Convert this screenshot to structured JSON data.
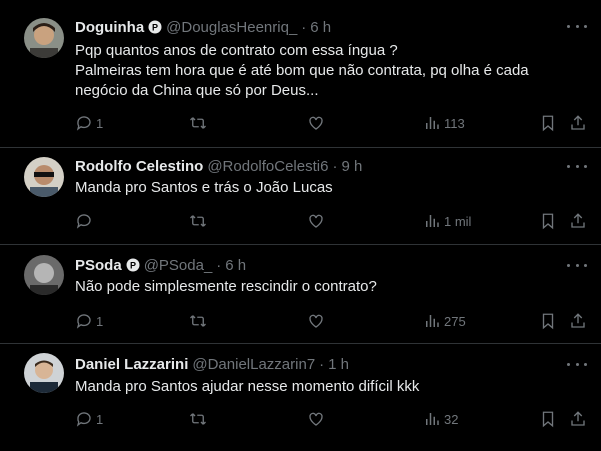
{
  "tweets": [
    {
      "name": "Doguinha",
      "handle": "@DouglasHeenriq_",
      "time": "6 h",
      "text_lines": [
        "Pqp quantos anos de contrato com essa íngua ?",
        "Palmeiras tem hora que é até bom que não contrata, pq olha é cada",
        "negócio da China que só por Deus..."
      ],
      "replies": "1",
      "views": "113",
      "verified": true
    },
    {
      "name": "Rodolfo Celestino",
      "handle": "@RodolfoCelesti6",
      "time": "9 h",
      "text_lines": [
        "Manda pro Santos e trás o João Lucas"
      ],
      "replies": "",
      "views": "1 mil",
      "verified": false
    },
    {
      "name": "PSoda",
      "handle": "@PSoda_",
      "time": "6 h",
      "text_lines": [
        "Não pode simplesmente rescindir o contrato?"
      ],
      "replies": "1",
      "views": "275",
      "verified": true
    },
    {
      "name": "Daniel Lazzarini",
      "handle": "@DanielLazzarin7",
      "time": "1 h",
      "text_lines": [
        "Manda pro Santos ajudar nesse momento difícil kkk"
      ],
      "replies": "1",
      "views": "32",
      "verified": false
    }
  ],
  "separator": "·",
  "icons": [
    "verified-badge-icon",
    "more-icon",
    "reply-icon",
    "retweet-icon",
    "like-icon",
    "views-icon",
    "bookmark-icon",
    "share-icon"
  ],
  "colors": {
    "background": "#000000",
    "text": "#e7e9ea",
    "muted": "#71767b",
    "divider": "#2f3336"
  }
}
